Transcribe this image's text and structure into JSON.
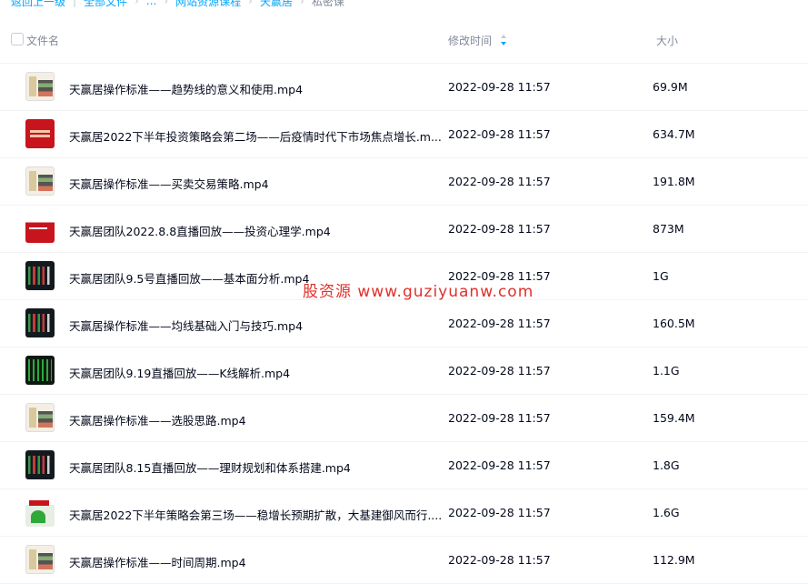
{
  "breadcrumb": {
    "back": "返回上一级",
    "items": [
      "全部文件",
      "...",
      "网站资源课程",
      "天赢居",
      "私密课"
    ]
  },
  "columns": {
    "name": "文件名",
    "modified": "修改时间",
    "size": "大小"
  },
  "accent_color": "#06a7ff",
  "files": [
    {
      "name": "天赢居操作标准——趋势线的意义和使用.mp4",
      "modified": "2022-09-28 11:57",
      "size": "69.9M",
      "thumb": "chart-light"
    },
    {
      "name": "天赢居2022下半年投资策略会第二场——后疫情时代下市场焦点增长.m...",
      "modified": "2022-09-28 11:57",
      "size": "634.7M",
      "thumb": "red"
    },
    {
      "name": "天赢居操作标准——买卖交易策略.mp4",
      "modified": "2022-09-28 11:57",
      "size": "191.8M",
      "thumb": "chart-light"
    },
    {
      "name": "天赢居团队2022.8.8直播回放——投资心理学.mp4",
      "modified": "2022-09-28 11:57",
      "size": "873M",
      "thumb": "red-white"
    },
    {
      "name": "天赢居团队9.5号直播回放——基本面分析.mp4",
      "modified": "2022-09-28 11:57",
      "size": "1G",
      "thumb": "dark"
    },
    {
      "name": "天赢居操作标准——均线基础入门与技巧.mp4",
      "modified": "2022-09-28 11:57",
      "size": "160.5M",
      "thumb": "dark"
    },
    {
      "name": "天赢居团队9.19直播回放——K线解析.mp4",
      "modified": "2022-09-28 11:57",
      "size": "1.1G",
      "thumb": "dark-green"
    },
    {
      "name": "天赢居操作标准——选股思路.mp4",
      "modified": "2022-09-28 11:57",
      "size": "159.4M",
      "thumb": "chart-light"
    },
    {
      "name": "天赢居团队8.15直播回放——理财规划和体系搭建.mp4",
      "modified": "2022-09-28 11:57",
      "size": "1.8G",
      "thumb": "dark"
    },
    {
      "name": "天赢居2022下半年策略会第三场——稳增长预期扩散，大基建御风而行....",
      "modified": "2022-09-28 11:57",
      "size": "1.6G",
      "thumb": "red-green"
    },
    {
      "name": "天赢居操作标准——时间周期.mp4",
      "modified": "2022-09-28 11:57",
      "size": "112.9M",
      "thumb": "chart-light"
    }
  ],
  "watermark": "股资源 www.guziyuanw.com"
}
